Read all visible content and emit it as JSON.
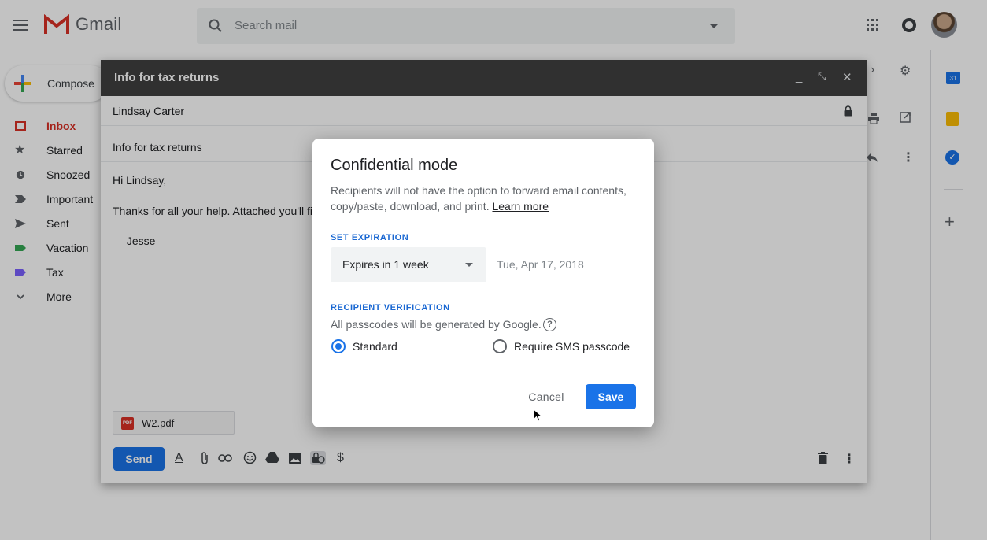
{
  "app": {
    "name": "Gmail"
  },
  "search": {
    "placeholder": "Search mail"
  },
  "sidebar": {
    "compose_label": "Compose",
    "items": [
      {
        "label": "Inbox",
        "icon": "inbox-icon"
      },
      {
        "label": "Starred",
        "icon": "star-icon"
      },
      {
        "label": "Snoozed",
        "icon": "clock-icon"
      },
      {
        "label": "Important",
        "icon": "important-icon"
      },
      {
        "label": "Sent",
        "icon": "send-icon"
      },
      {
        "label": "Vacation",
        "icon": "label-icon"
      },
      {
        "label": "Tax",
        "icon": "label-icon"
      },
      {
        "label": "More",
        "icon": "chevron-down-icon"
      }
    ]
  },
  "compose": {
    "title": "Info for tax returns",
    "to": "Lindsay Carter",
    "subject": "Info for tax returns",
    "body_lines": [
      "Hi Lindsay,",
      "Thanks for all your help. Attached you'll fin",
      "— Jesse"
    ],
    "attachment": "W2.pdf",
    "attachment_badge": "PDF",
    "send_label": "Send"
  },
  "dialog": {
    "title": "Confidential mode",
    "description_line1": "Recipients will not have the option to forward email contents,",
    "description_line2": "copy/paste, download, and print.",
    "learn_more": "Learn more",
    "expiration_heading": "SET EXPIRATION",
    "expiration_value": "Expires in 1 week",
    "expiration_date": "Tue, Apr 17, 2018",
    "verification_heading": "RECIPIENT VERIFICATION",
    "verification_note": "All passcodes will be generated by Google.",
    "help_symbol": "?",
    "options": [
      {
        "label": "Standard",
        "selected": true
      },
      {
        "label": "Require SMS passcode",
        "selected": false
      }
    ],
    "cancel_label": "Cancel",
    "save_label": "Save"
  },
  "sidepanel": {
    "calendar_day": "31"
  },
  "colors": {
    "accent": "#1a73e8",
    "inbox_red": "#d93025",
    "vacation_label": "#34a853",
    "tax_label": "#7b61ff"
  }
}
